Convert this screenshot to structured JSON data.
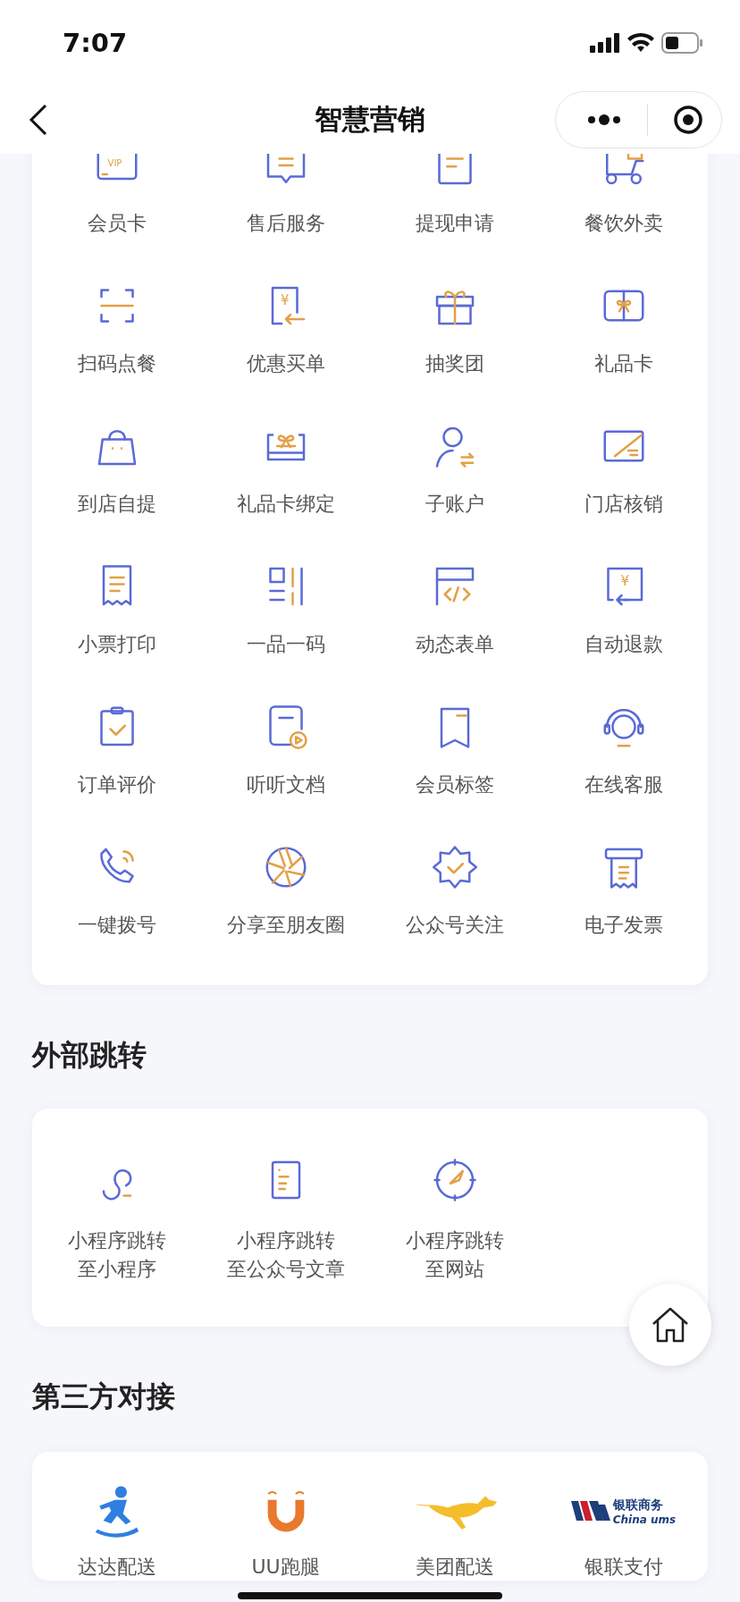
{
  "status_bar": {
    "time": "7:07"
  },
  "nav": {
    "title": "智慧营销"
  },
  "features": {
    "items": [
      {
        "label": "会员卡",
        "icon_text": "VIP"
      },
      {
        "label": "售后服务"
      },
      {
        "label": "提现申请"
      },
      {
        "label": "餐饮外卖"
      },
      {
        "label": "扫码点餐"
      },
      {
        "label": "优惠买单",
        "icon_text": "¥"
      },
      {
        "label": "抽奖团"
      },
      {
        "label": "礼品卡"
      },
      {
        "label": "到店自提"
      },
      {
        "label": "礼品卡绑定"
      },
      {
        "label": "子账户"
      },
      {
        "label": "门店核销"
      },
      {
        "label": "小票打印"
      },
      {
        "label": "一品一码"
      },
      {
        "label": "动态表单"
      },
      {
        "label": "自动退款",
        "icon_text": "¥"
      },
      {
        "label": "订单评价"
      },
      {
        "label": "听听文档"
      },
      {
        "label": "会员标签"
      },
      {
        "label": "在线客服"
      },
      {
        "label": "一键拨号"
      },
      {
        "label": "分享至朋友圈"
      },
      {
        "label": "公众号关注"
      },
      {
        "label": "电子发票"
      }
    ]
  },
  "external": {
    "title": "外部跳转",
    "items": [
      {
        "lines": [
          "小程序跳转",
          "至小程序"
        ]
      },
      {
        "lines": [
          "小程序跳转",
          "至公众号文章"
        ]
      },
      {
        "lines": [
          "小程序跳转",
          "至网站"
        ]
      }
    ]
  },
  "third_party": {
    "title": "第三方对接",
    "items": [
      {
        "label": "达达配送"
      },
      {
        "label": "UU跑腿"
      },
      {
        "label": "美团配送"
      },
      {
        "label": "银联支付",
        "logo_text": "银联商务",
        "logo_subtext": "China ums"
      }
    ]
  }
}
